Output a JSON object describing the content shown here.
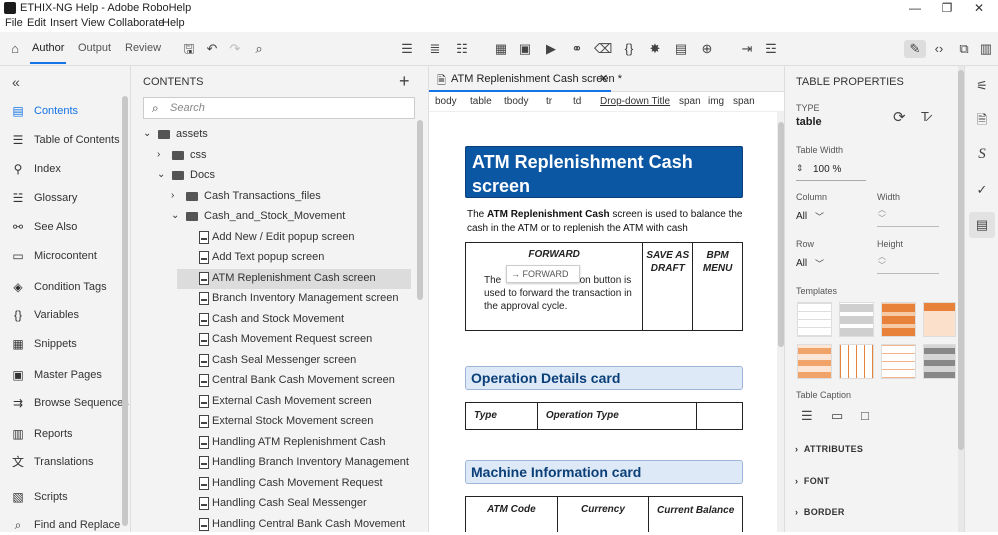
{
  "window": {
    "title": "ETHIX-NG Help - Adobe RoboHelp",
    "minimize": "—",
    "restore": "❐",
    "close": "✕"
  },
  "menu": [
    "File",
    "Edit",
    "Insert",
    "View",
    "Collaborate",
    "Help"
  ],
  "top_tabs": {
    "author": "Author",
    "output": "Output",
    "review": "Review"
  },
  "left_nav": [
    {
      "label": "Contents",
      "icon": "contents-icon",
      "active": true
    },
    {
      "label": "Table of Contents",
      "icon": "toc-icon"
    },
    {
      "label": "Index",
      "icon": "index-icon"
    },
    {
      "label": "Glossary",
      "icon": "glossary-icon"
    },
    {
      "label": "See Also",
      "icon": "see-also-icon"
    },
    {
      "label": "Microcontent",
      "icon": "microcontent-icon"
    },
    {
      "label": "Condition Tags",
      "icon": "tag-icon"
    },
    {
      "label": "Variables",
      "icon": "variables-icon"
    },
    {
      "label": "Snippets",
      "icon": "snippets-icon"
    },
    {
      "label": "Master Pages",
      "icon": "master-pages-icon"
    },
    {
      "label": "Browse Sequences",
      "icon": "browse-sequences-icon"
    },
    {
      "label": "Reports",
      "icon": "reports-icon"
    },
    {
      "label": "Translations",
      "icon": "translations-icon"
    },
    {
      "label": "Scripts",
      "icon": "scripts-icon"
    },
    {
      "label": "Find and Replace",
      "icon": "find-replace-icon"
    }
  ],
  "contents_panel": {
    "header": "CONTENTS",
    "search_placeholder": "Search",
    "tree": [
      {
        "label": "assets",
        "level": 0,
        "type": "folder",
        "expanded": true
      },
      {
        "label": "css",
        "level": 1,
        "type": "folder",
        "expanded": false
      },
      {
        "label": "Docs",
        "level": 1,
        "type": "folder",
        "expanded": true
      },
      {
        "label": "Cash Transactions_files",
        "level": 2,
        "type": "folder",
        "expanded": false
      },
      {
        "label": "Cash_and_Stock_Movement",
        "level": 2,
        "type": "folder",
        "expanded": true
      },
      {
        "label": "Add New / Edit popup screen",
        "level": 3,
        "type": "file"
      },
      {
        "label": "Add Text popup screen",
        "level": 3,
        "type": "file"
      },
      {
        "label": "ATM Replenishment Cash screen",
        "level": 3,
        "type": "file",
        "selected": true
      },
      {
        "label": "Branch Inventory Management screen",
        "level": 3,
        "type": "file"
      },
      {
        "label": "Cash and Stock Movement",
        "level": 3,
        "type": "file"
      },
      {
        "label": "Cash Movement Request screen",
        "level": 3,
        "type": "file"
      },
      {
        "label": "Cash Seal Messenger screen",
        "level": 3,
        "type": "file"
      },
      {
        "label": "Central Bank Cash Movement screen",
        "level": 3,
        "type": "file"
      },
      {
        "label": "External Cash Movement screen",
        "level": 3,
        "type": "file"
      },
      {
        "label": "External Stock Movement screen",
        "level": 3,
        "type": "file"
      },
      {
        "label": "Handling ATM Replenishment Cash",
        "level": 3,
        "type": "file"
      },
      {
        "label": "Handling Branch Inventory Management",
        "level": 3,
        "type": "file"
      },
      {
        "label": "Handling Cash Movement Request",
        "level": 3,
        "type": "file"
      },
      {
        "label": "Handling Cash Seal Messenger",
        "level": 3,
        "type": "file"
      },
      {
        "label": "Handling Central Bank Cash Movement",
        "level": 3,
        "type": "file"
      }
    ]
  },
  "editor": {
    "tab_title": "ATM Replenishment Cash screen *",
    "breadcrumb": [
      "body",
      "table",
      "tbody",
      "tr",
      "td",
      "Drop-down Title",
      "span",
      "img",
      "span"
    ],
    "heading": "ATM Replenishment Cash screen",
    "intro_pre": "The ",
    "intro_bold": "ATM Replenishment Cash",
    "intro_post": " screen is used to balance the cash in the ATM or to replenish the ATM with cash",
    "forward_title": "FORWARD",
    "forward_button": "FORWARD",
    "forward_desc_pre": "The",
    "forward_desc_post": "action button is used to forward the transaction in the approval cycle.",
    "save_draft": "SAVE AS DRAFT",
    "bpm_menu": "BPM MENU",
    "operation_heading": "Operation Details card",
    "operation_cols": [
      "Type",
      "Operation Type",
      ""
    ],
    "machine_heading": "Machine Information card",
    "machine_cols": [
      "ATM Code",
      "Currency",
      "Current Balance"
    ]
  },
  "properties": {
    "header": "TABLE PROPERTIES",
    "type_label": "TYPE",
    "type_value": "table",
    "table_width_label": "Table Width",
    "table_width_value": "100 %",
    "column_label": "Column",
    "column_value": "All",
    "width_label": "Width",
    "row_label": "Row",
    "row_value": "All",
    "height_label": "Height",
    "templates_label": "Templates",
    "caption_label": "Table Caption",
    "sections": [
      "ATTRIBUTES",
      "FONT",
      "BORDER"
    ]
  }
}
